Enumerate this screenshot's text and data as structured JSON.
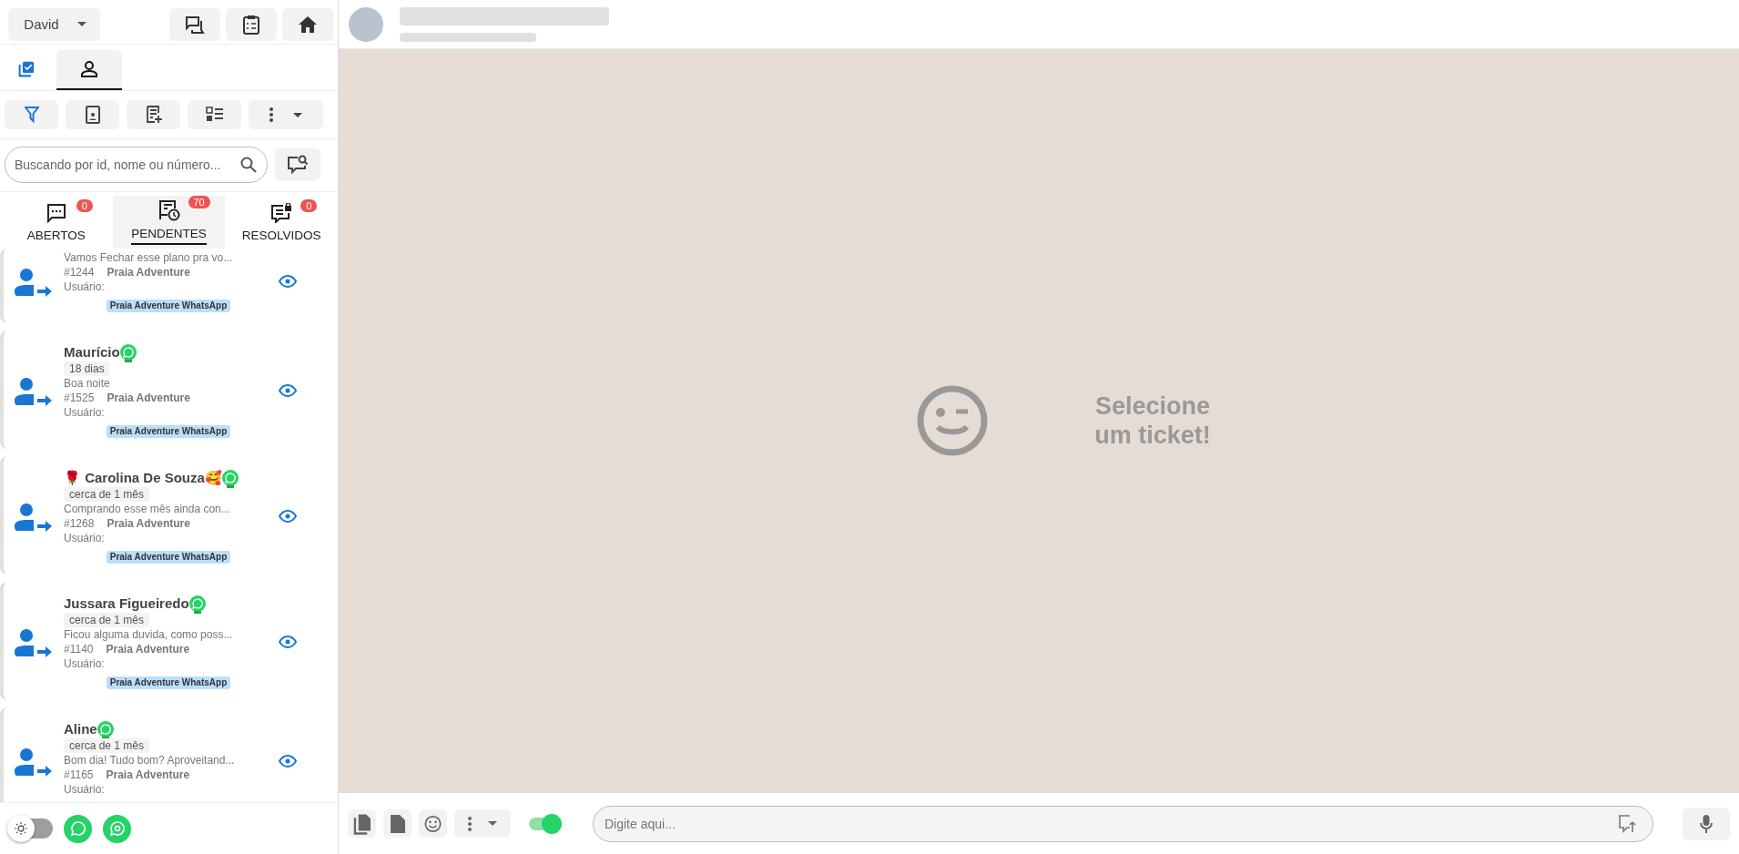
{
  "user_menu": {
    "label": "David"
  },
  "view_tabs": [
    {
      "kind": "check",
      "selected": false
    },
    {
      "kind": "person",
      "selected": true
    }
  ],
  "search": {
    "placeholder": "Buscando por id, nome ou número..."
  },
  "status_tabs": [
    {
      "kind": "open",
      "label": "ABERTOS",
      "count": "0",
      "selected": false
    },
    {
      "kind": "pending",
      "label": "PENDENTES",
      "count": "70",
      "selected": true
    },
    {
      "kind": "closed",
      "label": "RESOLVIDOS",
      "count": "0",
      "selected": false
    }
  ],
  "tickets": [
    {
      "message": "Vamos Fechar esse plano pra vo...",
      "id": "#1244",
      "queue": "Praia Adventure",
      "user": "Usuário:",
      "tag": "Praia Adventure WhatsApp"
    },
    {
      "name": "Maurício",
      "time": "18 dias",
      "message": "Boa noite",
      "id": "#1525",
      "queue": "Praia Adventure",
      "user": "Usuário:",
      "tag": "Praia Adventure WhatsApp"
    },
    {
      "name": "🌹 Carolina De Souza🥰",
      "time": "cerca de 1 mês",
      "message": "Comprando esse mês ainda con...",
      "id": "#1268",
      "queue": "Praia Adventure",
      "user": "Usuário:",
      "tag": "Praia Adventure WhatsApp"
    },
    {
      "name": "Jussara Figueiredo",
      "time": "cerca de 1 mês",
      "message": "Ficou alguma duvida, como poss...",
      "id": "#1140",
      "queue": "Praia Adventure",
      "user": "Usuário:",
      "tag": "Praia Adventure WhatsApp"
    },
    {
      "name": "Aline",
      "time": "cerca de 1 mês",
      "message": "Bom dia! Tudo bom? Aproveitand...",
      "id": "#1165",
      "queue": "Praia Adventure",
      "user": "Usuário:"
    }
  ],
  "theme_toggle": {
    "on": false
  },
  "chat": {
    "message": "Selecione um ticket!"
  },
  "composer": {
    "placeholder": "Digite aqui...",
    "signature": {
      "on": true
    }
  }
}
